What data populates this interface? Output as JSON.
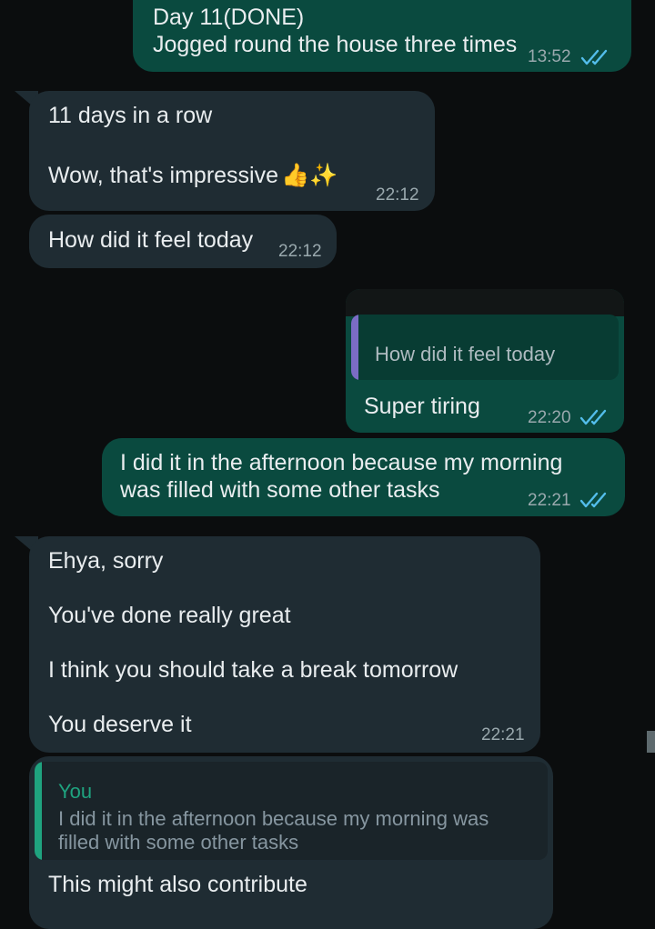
{
  "messages": [
    {
      "line1": "Day 11(DONE)",
      "line2": "Jogged round the house three times",
      "time": "13:52"
    },
    {
      "line1": "11 days in a row",
      "line2": "Wow, that's impressive",
      "emoji": "👍✨",
      "time": "22:12"
    },
    {
      "text": "How did it feel today",
      "time": "22:12"
    },
    {
      "quote_text": "How did it feel today",
      "text": "Super tiring",
      "time": "22:20"
    },
    {
      "line1": "I did it in the afternoon because my morning",
      "line2": "was filled with some other tasks",
      "time": "22:21"
    },
    {
      "lines": [
        "Ehya, sorry",
        "You've done really great",
        "I think you should take a break tomorrow",
        "You deserve it"
      ],
      "time": "22:21"
    },
    {
      "quote_author": "You",
      "quote_line1": "I did it in the afternoon because my morning was",
      "quote_line2": "filled with some other tasks",
      "text": "This might also contribute"
    }
  ],
  "colors": {
    "outgoing_bubble": "#0a4a3f",
    "incoming_bubble": "#1f2c33",
    "read_ticks": "#53bdeb",
    "quote_author": "#1fa37f"
  },
  "icons": [
    "double-check-read-icon"
  ]
}
